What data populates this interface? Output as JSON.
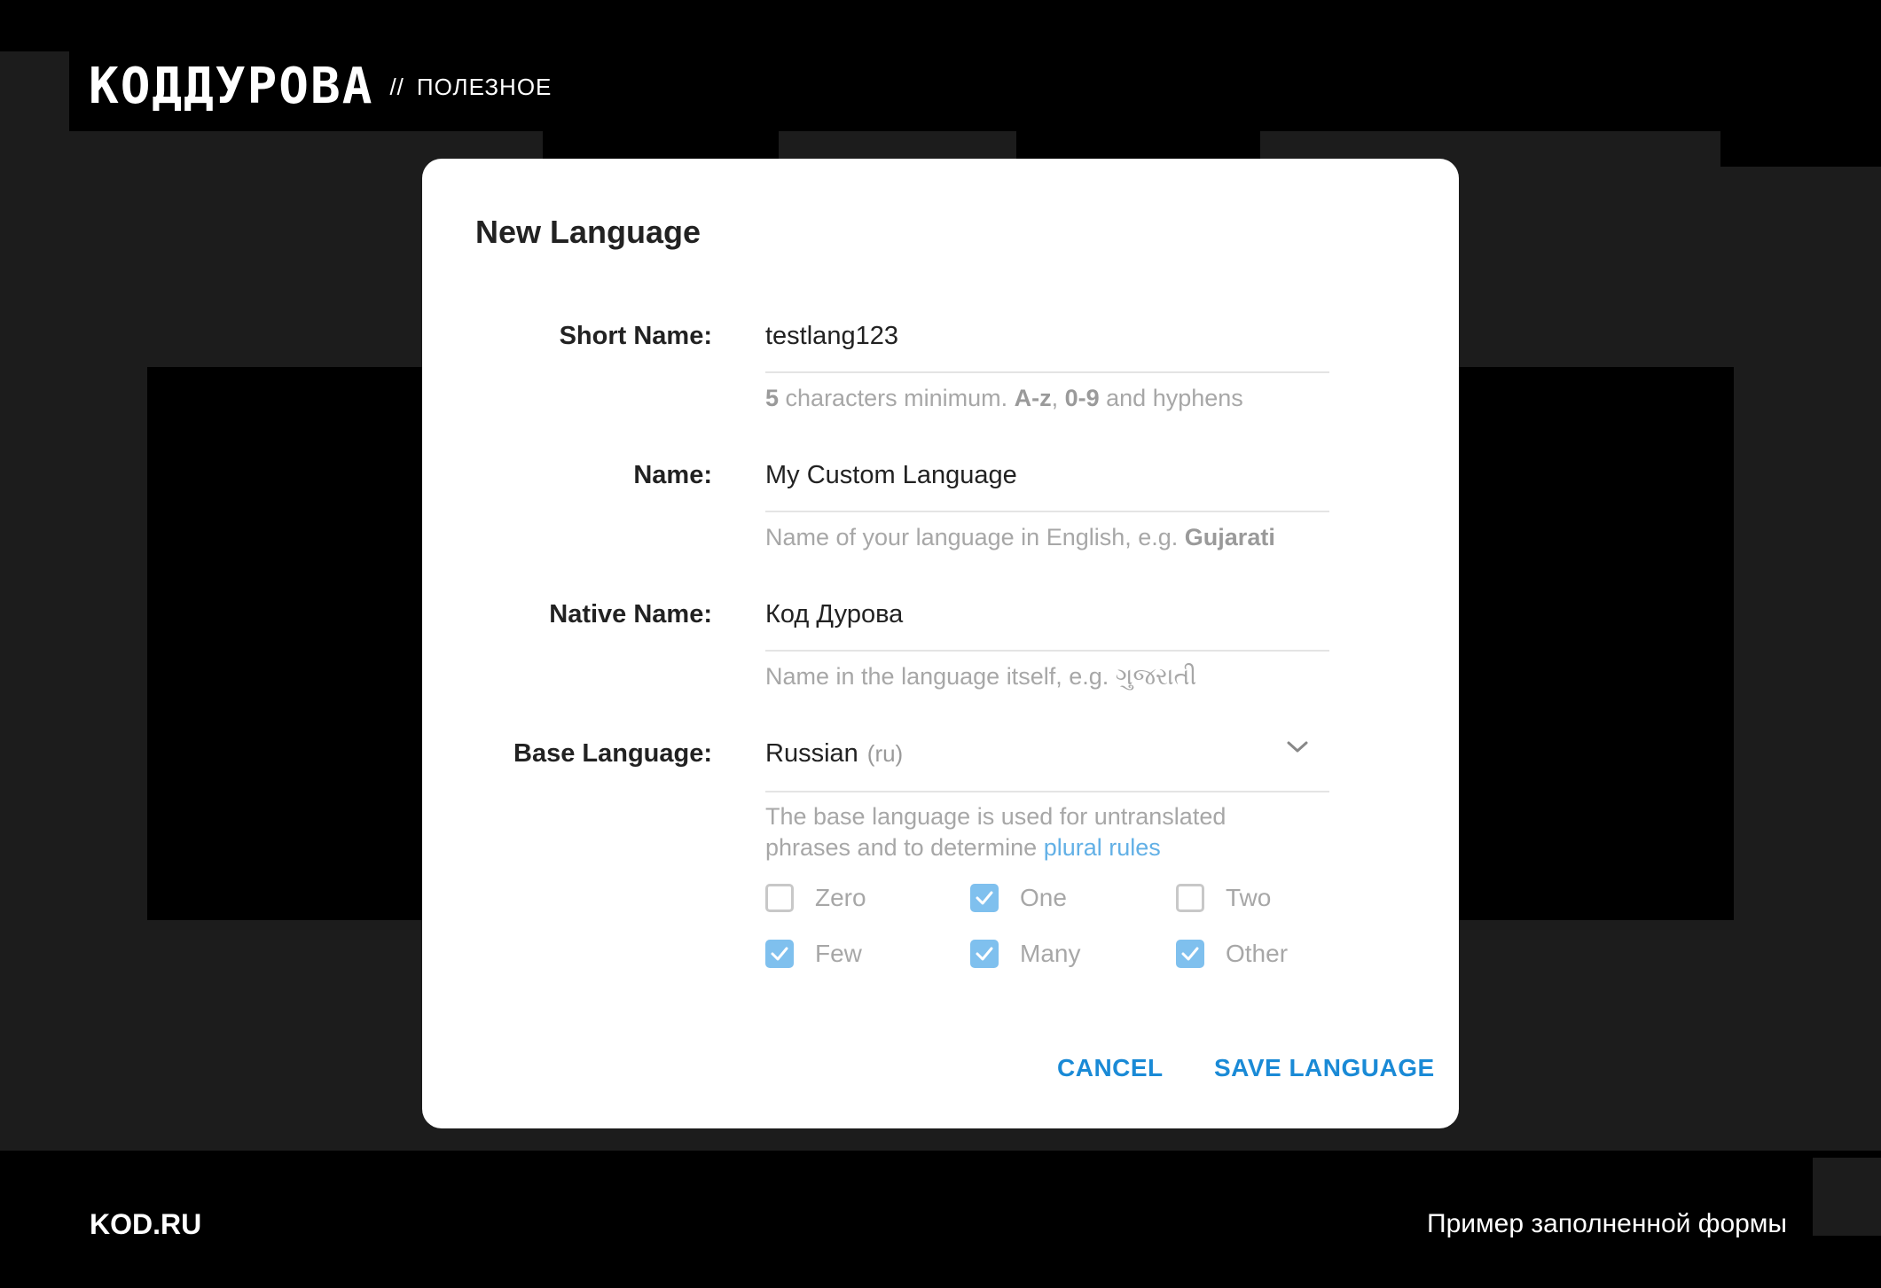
{
  "header": {
    "logo": "КОДДУРОВА",
    "separator": "//",
    "section": "ПОЛЕЗНОЕ"
  },
  "footer": {
    "site": "KOD.RU",
    "caption": "Пример заполненной формы"
  },
  "dialog": {
    "title": "New Language",
    "short_name": {
      "label": "Short Name:",
      "value": "testlang123",
      "hint_parts": [
        "5",
        " characters minimum. ",
        "A-z",
        ", ",
        "0-9",
        " and hyphens"
      ]
    },
    "name": {
      "label": "Name:",
      "value": "My Custom Language",
      "hint_prefix": "Name of your language in English, e.g. ",
      "hint_example": "Gujarati"
    },
    "native_name": {
      "label": "Native Name:",
      "value": "Код Дурова",
      "hint_prefix": "Name in the language itself, e.g. ",
      "hint_example": "ગુજરાતી"
    },
    "base_language": {
      "label": "Base Language:",
      "selected": "Russian",
      "selected_code": "(ru)",
      "hint_line1": "The base language is used for untranslated",
      "hint_line2": "phrases and to determine ",
      "hint_link": "plural rules"
    },
    "plural_rules": [
      {
        "label": "Zero",
        "checked": false
      },
      {
        "label": "One",
        "checked": true
      },
      {
        "label": "Two",
        "checked": false
      },
      {
        "label": "Few",
        "checked": true
      },
      {
        "label": "Many",
        "checked": true
      },
      {
        "label": "Other",
        "checked": true
      }
    ],
    "buttons": {
      "cancel": "CANCEL",
      "save": "SAVE LANGUAGE"
    }
  },
  "colors": {
    "accent": "#1a8ad6",
    "checkbox_checked": "#7fc0ee",
    "link": "#62b0e6"
  }
}
